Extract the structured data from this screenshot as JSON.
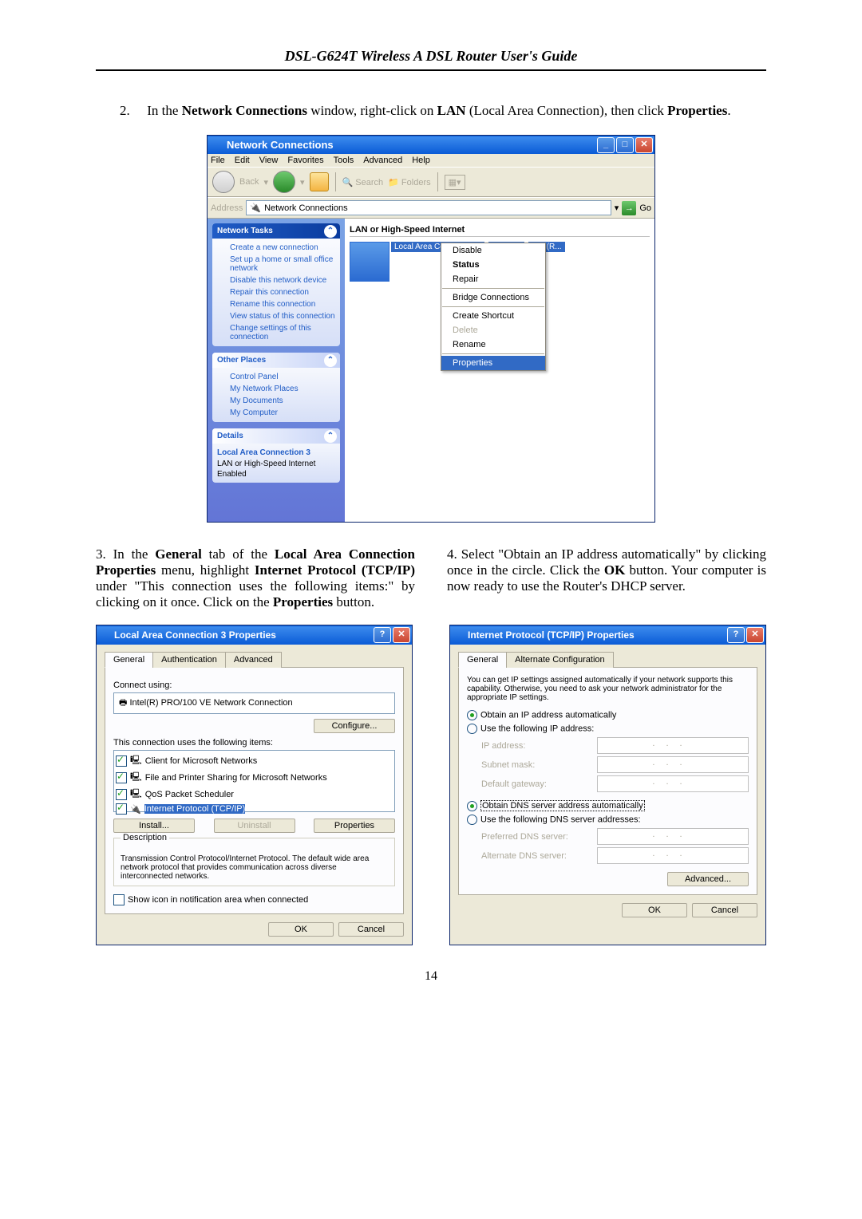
{
  "header_title": "DSL-G624T Wireless A DSL Router User's Guide",
  "page_number": "14",
  "step2": {
    "num": "2.",
    "pre": "In the ",
    "b1": "Network Connections",
    "mid1": " window, right-click on ",
    "b2": "LAN",
    "mid2": " (Local Area Connection), then click ",
    "b3": "Properties",
    "post": "."
  },
  "win1": {
    "title": "Network Connections",
    "menu": [
      "File",
      "Edit",
      "View",
      "Favorites",
      "Tools",
      "Advanced",
      "Help"
    ],
    "back": "Back",
    "search": "Search",
    "folders": "Folders",
    "addr_label": "Address",
    "addr_value": "Network Connections",
    "go": "Go",
    "cat": "LAN or High-Speed Internet",
    "conn_line1": "Local Area Connection 3",
    "conn_line2": "Enabled",
    "conn_line3": "Intel(R...",
    "ctx": [
      "Disable",
      "Status",
      "Repair",
      "",
      "Bridge Connections",
      "",
      "Create Shortcut",
      "Delete",
      "Rename",
      "",
      "Properties"
    ],
    "panels": {
      "tasks": {
        "title": "Network Tasks",
        "items": [
          "Create a new connection",
          "Set up a home or small office network",
          "Disable this network device",
          "Repair this connection",
          "Rename this connection",
          "View status of this connection",
          "Change settings of this connection"
        ]
      },
      "places": {
        "title": "Other Places",
        "items": [
          "Control Panel",
          "My Network Places",
          "My Documents",
          "My Computer"
        ]
      },
      "details": {
        "title": "Details",
        "l1": "Local Area Connection 3",
        "l2": "LAN or High-Speed Internet",
        "l3": "Enabled"
      }
    }
  },
  "step3": {
    "pre": "3. In the ",
    "b1": "General",
    "m1": " tab of the ",
    "b2": "Local Area Connection Properties",
    "m2": " menu, highlight ",
    "b3": "Internet Protocol (TCP/IP)",
    "m3": " under \"This connection uses the following items:\" by clicking on it once. Click on the ",
    "b4": "Properties",
    "post": " button."
  },
  "step4": {
    "pre": "4. Select \"Obtain an IP address automatically\" by clicking once in the circle. Click the ",
    "b1": "OK",
    "m1": " button. Your computer is now ready to use the Router's DHCP server."
  },
  "dlg1": {
    "title": "Local Area Connection 3 Properties",
    "tabs": [
      "General",
      "Authentication",
      "Advanced"
    ],
    "connect_using": "Connect using:",
    "adapter": "Intel(R) PRO/100 VE Network Connection",
    "configure": "Configure...",
    "uses": "This connection uses the following items:",
    "items": [
      "Client for Microsoft Networks",
      "File and Printer Sharing for Microsoft Networks",
      "QoS Packet Scheduler",
      "Internet Protocol (TCP/IP)"
    ],
    "install": "Install...",
    "uninstall": "Uninstall",
    "properties": "Properties",
    "desc_lbl": "Description",
    "desc": "Transmission Control Protocol/Internet Protocol. The default wide area network protocol that provides communication across diverse interconnected networks.",
    "show_icon": "Show icon in notification area when connected",
    "ok": "OK",
    "cancel": "Cancel"
  },
  "dlg2": {
    "title": "Internet Protocol (TCP/IP) Properties",
    "tabs": [
      "General",
      "Alternate Configuration"
    ],
    "intro": "You can get IP settings assigned automatically if your network supports this capability. Otherwise, you need to ask your network administrator for the appropriate IP settings.",
    "r1": "Obtain an IP address automatically",
    "r2": "Use the following IP address:",
    "ip": "IP address:",
    "mask": "Subnet mask:",
    "gw": "Default gateway:",
    "r3": "Obtain DNS server address automatically",
    "r4": "Use the following DNS server addresses:",
    "pdns": "Preferred DNS server:",
    "adns": "Alternate DNS server:",
    "advanced": "Advanced...",
    "ok": "OK",
    "cancel": "Cancel"
  }
}
